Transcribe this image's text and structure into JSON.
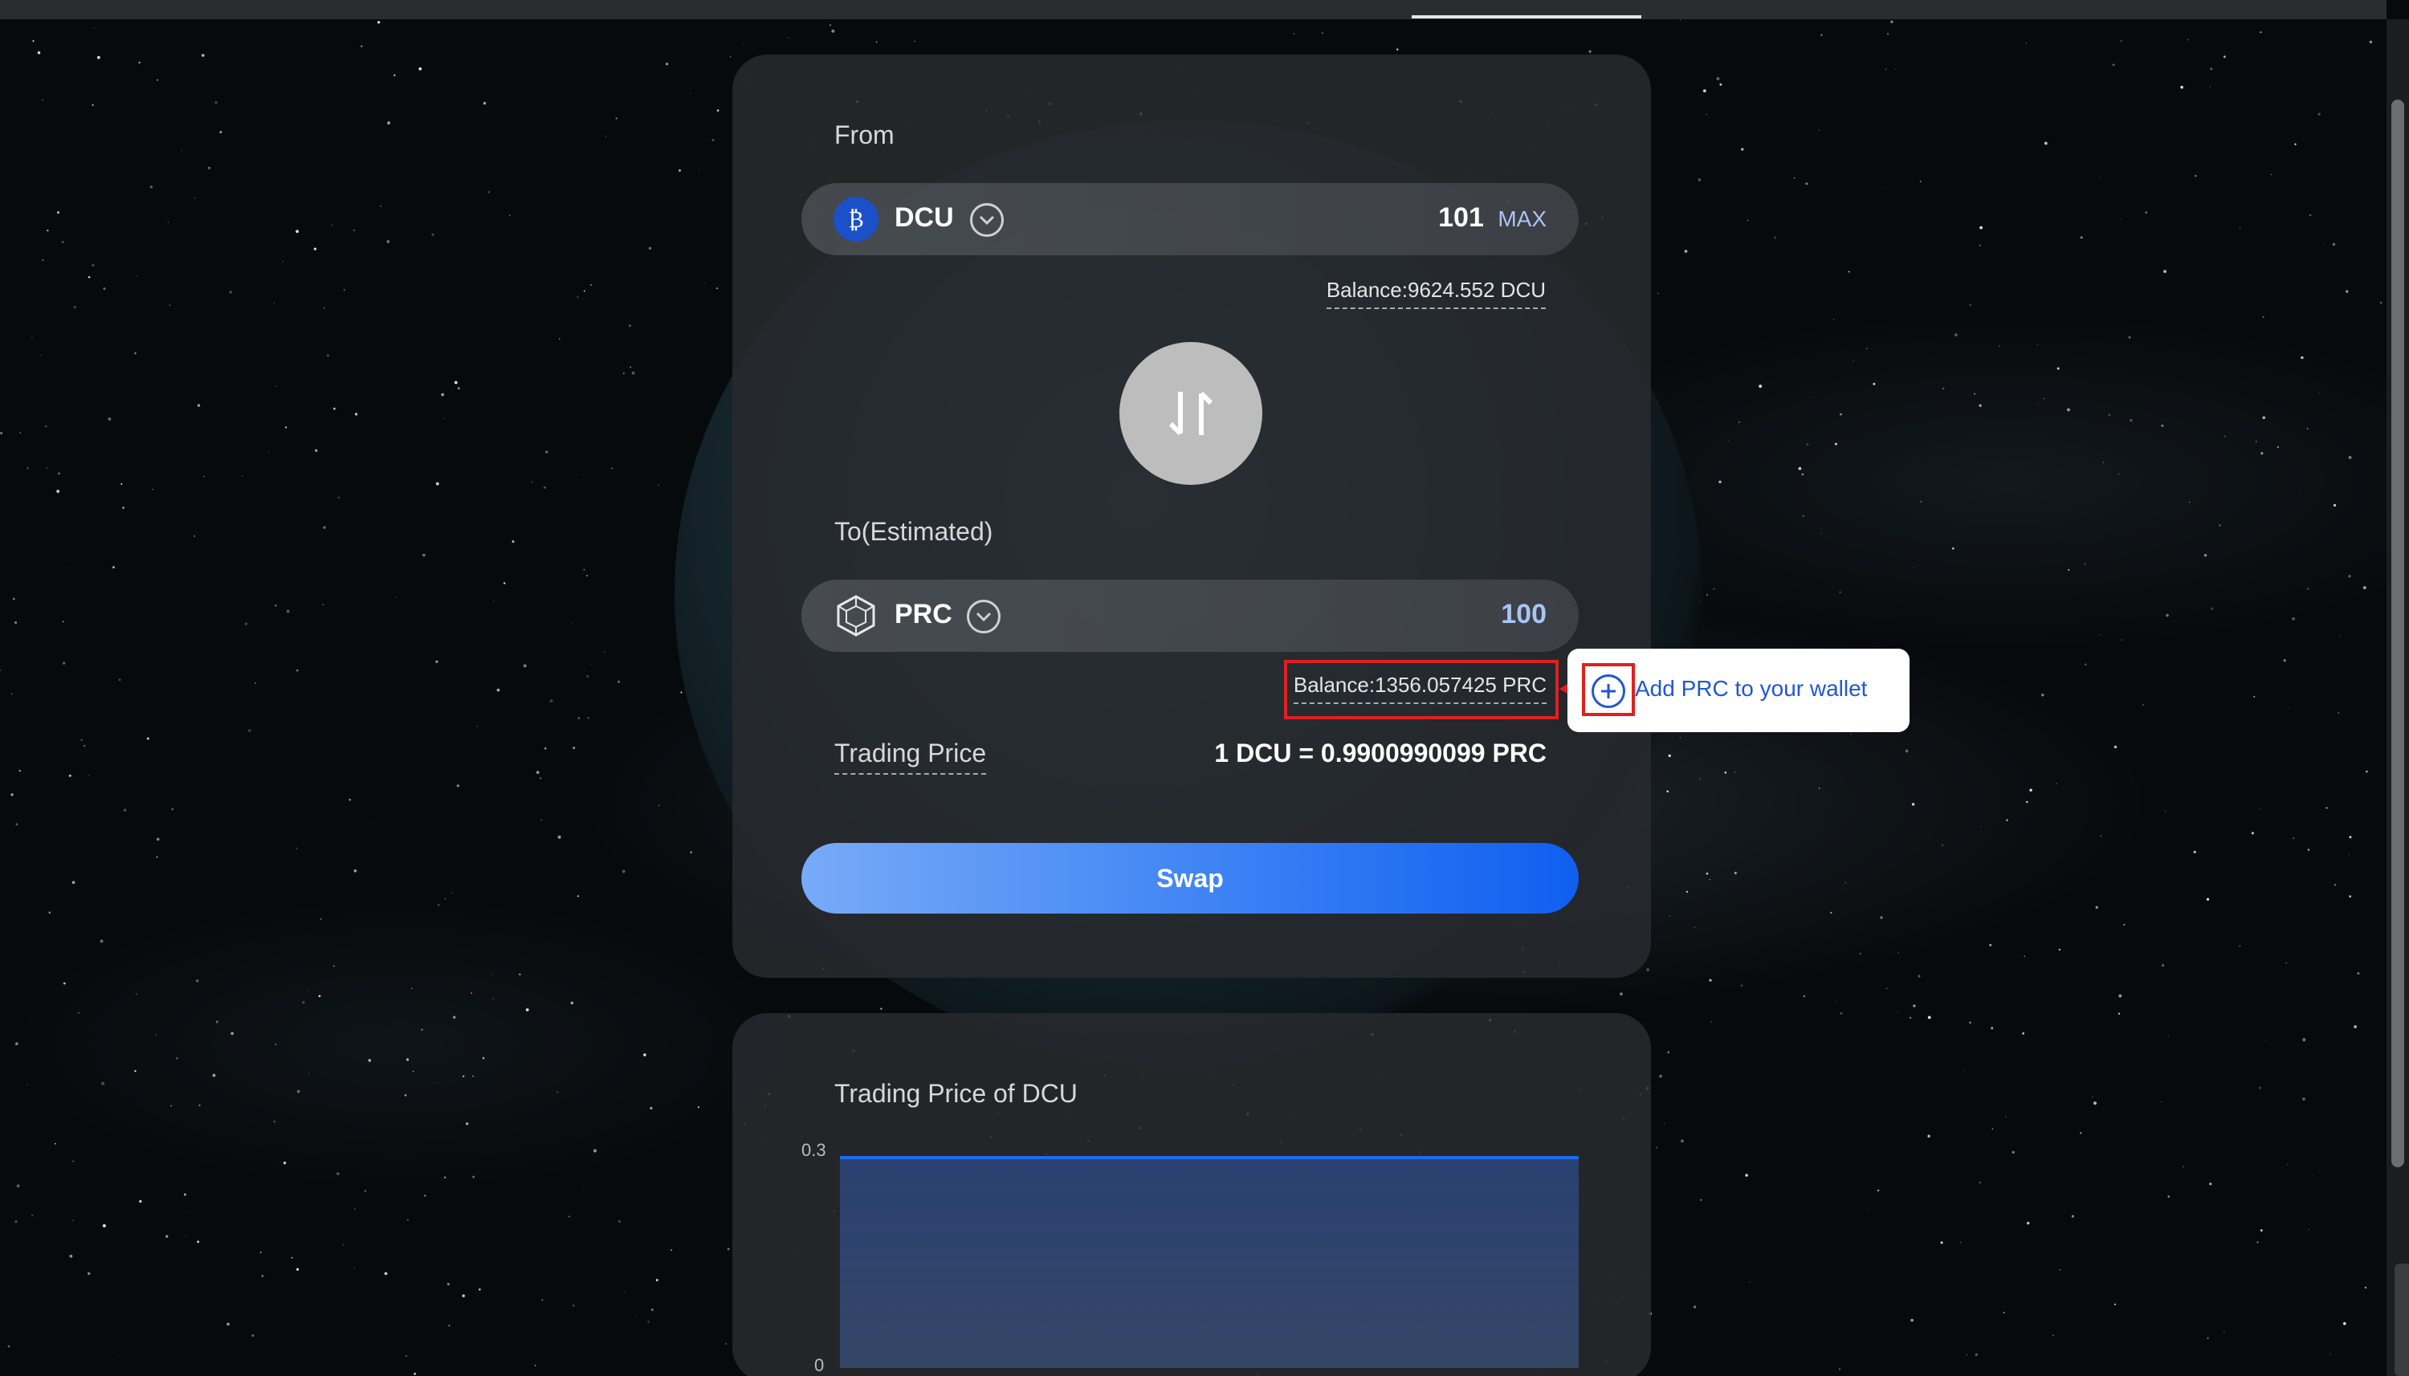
{
  "from": {
    "label": "From",
    "token": "DCU",
    "amount": "101",
    "max_label": "MAX",
    "balance": "Balance:9624.552 DCU"
  },
  "to": {
    "label": "To(Estimated)",
    "token": "PRC",
    "amount": "100",
    "balance": "Balance:1356.057425 PRC"
  },
  "tooltip": {
    "text": "Add PRC to your wallet"
  },
  "trading": {
    "label": "Trading Price",
    "value": "1 DCU = 0.9900990099 PRC"
  },
  "swap_button": "Swap",
  "chart_data": {
    "type": "area",
    "title": "Trading Price of DCU",
    "xlabel": "",
    "ylabel": "",
    "ylim": [
      0,
      0.3
    ],
    "y_ticks": [
      "0.3",
      "0"
    ],
    "series": [
      {
        "values": [
          0.3,
          0.3
        ]
      }
    ]
  },
  "colors": {
    "accent": "#1e6cf0",
    "dcu_icon": "#1c50c9",
    "highlight": "#e02020",
    "tooltip_text": "#2057d6"
  }
}
